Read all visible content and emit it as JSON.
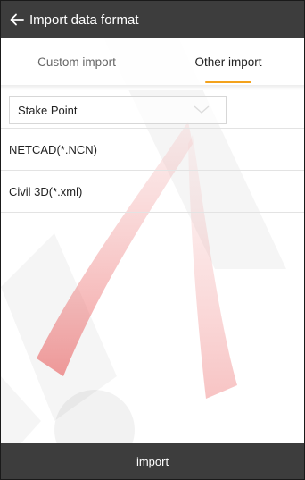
{
  "header": {
    "title": "Import data format",
    "back_icon": "arrow-left-icon"
  },
  "tabs": [
    {
      "label": "Custom import",
      "active": false
    },
    {
      "label": "Other import",
      "active": true
    }
  ],
  "accent_color": "#f3a21c",
  "header_color": "#3d3d3d",
  "select": {
    "value": "Stake Point",
    "icon": "chevron-down-icon"
  },
  "formats": [
    {
      "label": "NETCAD(*.NCN)"
    },
    {
      "label": "Civil 3D(*.xml)"
    }
  ],
  "footer": {
    "button_label": "import"
  }
}
